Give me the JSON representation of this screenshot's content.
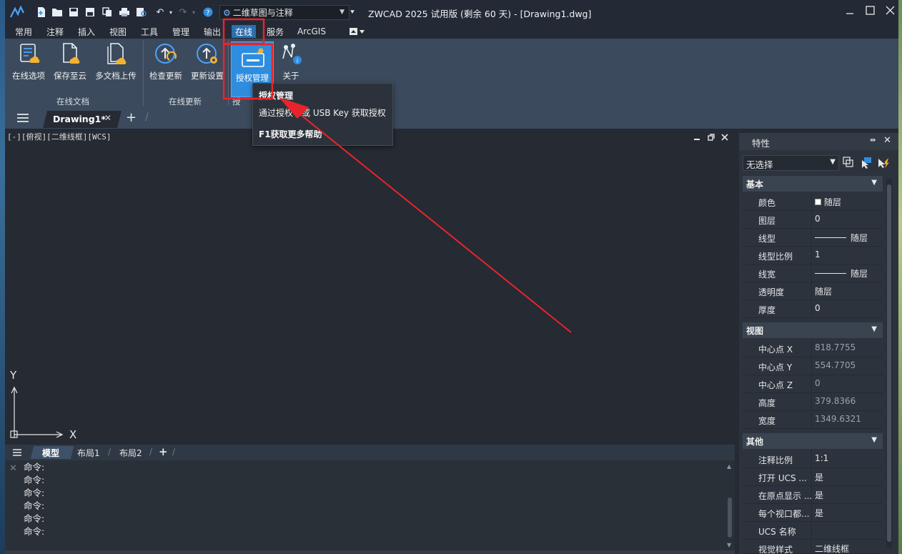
{
  "titlebar": {
    "workspace": "二维草图与注释",
    "title": "ZWCAD 2025 试用版 (剩余 60 天) - [Drawing1.dwg]"
  },
  "menu_tabs": [
    "常用",
    "注释",
    "插入",
    "视图",
    "工具",
    "管理",
    "输出",
    "在线",
    "服务",
    "ArcGIS"
  ],
  "active_tab": "在线",
  "ribbon": {
    "buttons": [
      {
        "label": "在线选项",
        "icon": "list-cloud-icon"
      },
      {
        "label": "保存至云",
        "icon": "document-cloud-icon"
      },
      {
        "label": "多文档上传",
        "icon": "multi-document-cloud-icon"
      },
      {
        "label": "检查更新",
        "icon": "update-check-icon"
      },
      {
        "label": "更新设置",
        "icon": "update-settings-icon"
      },
      {
        "label": "授权管理",
        "icon": "license-key-icon"
      },
      {
        "label": "关于",
        "icon": "about-info-icon"
      }
    ],
    "panels": [
      "在线文档",
      "在线更新",
      "授"
    ]
  },
  "tooltip": {
    "title": "授权管理",
    "desc": "通过授权号或 USB Key 获取授权",
    "help": "F1获取更多帮助"
  },
  "doc_tab": {
    "label": "Drawing1*"
  },
  "viewport": {
    "label": "[-][俯视][二维线框][WCS]",
    "axis_y": "Y",
    "axis_x": "X"
  },
  "layout_tabs": [
    "模型",
    "布局1",
    "布局2"
  ],
  "command_lines": [
    "命令:",
    "命令:",
    "命令:",
    "命令:",
    "命令:",
    "命令:"
  ],
  "properties": {
    "title": "特性",
    "selection": "无选择",
    "sections": [
      {
        "name": "基本",
        "rows": [
          {
            "name": "颜色",
            "value": "随层"
          },
          {
            "name": "图层",
            "value": "0"
          },
          {
            "name": "线型",
            "value": "随层"
          },
          {
            "name": "线型比例",
            "value": "1"
          },
          {
            "name": "线宽",
            "value": "随层"
          },
          {
            "name": "透明度",
            "value": "随层"
          },
          {
            "name": "厚度",
            "value": "0"
          }
        ]
      },
      {
        "name": "视图",
        "rows": [
          {
            "name": "中心点 X",
            "value": "818.7755"
          },
          {
            "name": "中心点 Y",
            "value": "554.7705"
          },
          {
            "name": "中心点 Z",
            "value": "0"
          },
          {
            "name": "高度",
            "value": "379.8366"
          },
          {
            "name": "宽度",
            "value": "1349.6321"
          }
        ]
      },
      {
        "name": "其他",
        "rows": [
          {
            "name": "注释比例",
            "value": "1:1"
          },
          {
            "name": "打开 UCS ...",
            "value": "是"
          },
          {
            "name": "在原点显示 ...",
            "value": "是"
          },
          {
            "name": "每个视口都...",
            "value": "是"
          },
          {
            "name": "UCS 名称",
            "value": ""
          },
          {
            "name": "视觉样式",
            "value": "二维线框"
          }
        ]
      }
    ]
  },
  "colors": {
    "accent": "#2f8de0",
    "highlight_box": "#e8242b",
    "arrow": "#e8242b"
  }
}
